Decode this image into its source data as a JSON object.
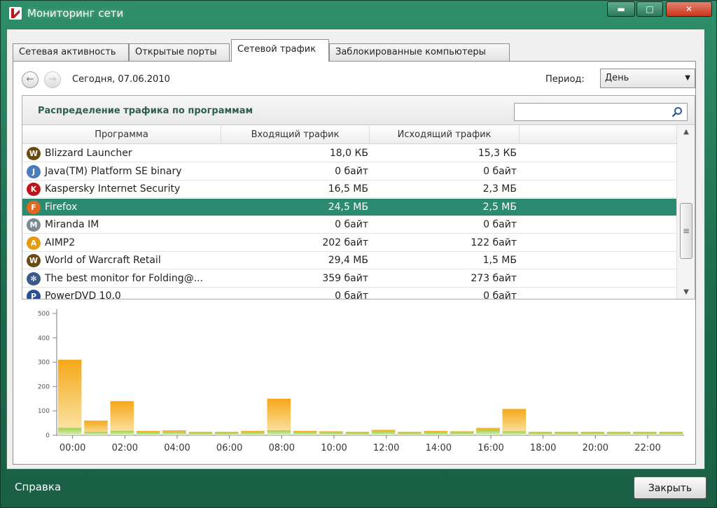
{
  "window": {
    "title": "Мониторинг сети",
    "minimize_glyph": "▬",
    "maximize_glyph": "□",
    "close_glyph": "✕"
  },
  "tabs": [
    {
      "label": "Сетевая активность",
      "active": false
    },
    {
      "label": "Открытые порты",
      "active": false
    },
    {
      "label": "Сетевой трафик",
      "active": true
    },
    {
      "label": "Заблокированные компьютеры",
      "active": false
    }
  ],
  "navigation": {
    "prev_glyph": "←",
    "next_glyph": "→",
    "date_label": "Сегодня, 07.06.2010",
    "period_label": "Период:",
    "period_value": "День"
  },
  "group": {
    "title": "Распределение трафика по программам",
    "search_value": "",
    "columns": [
      "Программа",
      "Входящий трафик",
      "Исходящий трафик"
    ]
  },
  "rows": [
    {
      "name": "Blizzard Launcher",
      "in": "18,0 КБ",
      "out": "15,3 КБ",
      "icon": "blizzard-icon",
      "icon_color": "#6b4a12",
      "icon_glyph": "W"
    },
    {
      "name": "Java(TM) Platform SE binary",
      "in": "0 байт",
      "out": "0 байт",
      "icon": "java-icon",
      "icon_color": "#4b7bbd",
      "icon_glyph": "J"
    },
    {
      "name": "Kaspersky Internet Security",
      "in": "16,5 МБ",
      "out": "2,3 МБ",
      "icon": "kaspersky-icon",
      "icon_color": "#c0141c",
      "icon_glyph": "K"
    },
    {
      "name": "Firefox",
      "in": "24,5 МБ",
      "out": "2,5 МБ",
      "icon": "firefox-icon",
      "icon_color": "#e2681d",
      "icon_glyph": "F",
      "selected": true
    },
    {
      "name": "Miranda IM",
      "in": "0 байт",
      "out": "0 байт",
      "icon": "miranda-icon",
      "icon_color": "#7d8a93",
      "icon_glyph": "M"
    },
    {
      "name": "AIMP2",
      "in": "202 байт",
      "out": "122 байт",
      "icon": "aimp-icon",
      "icon_color": "#e59a0c",
      "icon_glyph": "A"
    },
    {
      "name": "World of Warcraft Retail",
      "in": "29,4 МБ",
      "out": "1,5 МБ",
      "icon": "warcraft-icon",
      "icon_color": "#6b4a12",
      "icon_glyph": "W"
    },
    {
      "name": "The best monitor for Folding@...",
      "in": "359 байт",
      "out": "273 байт",
      "icon": "folding-icon",
      "icon_color": "#3a5a8c",
      "icon_glyph": "✻"
    },
    {
      "name": "PowerDVD 10.0",
      "in": "0 байт",
      "out": "0 байт",
      "icon": "powerdvd-icon",
      "icon_color": "#2d4f8f",
      "icon_glyph": "P"
    }
  ],
  "scrollbar": {
    "up_glyph": "▲",
    "down_glyph": "▼",
    "thumb_glyph": "≡"
  },
  "colors": {
    "selected_row": "#2c8a70",
    "bar_incoming": "#f5a818",
    "bar_outgoing": "#9fd04a"
  },
  "chart_data": {
    "type": "bar",
    "y_ticks": [
      "500",
      "400",
      "300",
      "200",
      "100",
      "0"
    ],
    "ylim": [
      0,
      500
    ],
    "x_tick_labels": [
      "00:00",
      "02:00",
      "04:00",
      "06:00",
      "08:00",
      "10:00",
      "12:00",
      "14:00",
      "16:00",
      "18:00",
      "20:00",
      "22:00"
    ],
    "categories": [
      "00",
      "01",
      "02",
      "03",
      "04",
      "05",
      "06",
      "07",
      "08",
      "09",
      "10",
      "11",
      "12",
      "13",
      "14",
      "15",
      "16",
      "17",
      "18",
      "19",
      "20",
      "21",
      "22",
      "23"
    ],
    "series": [
      {
        "values": [
          310,
          60,
          140,
          18,
          20,
          14,
          14,
          18,
          150,
          18,
          16,
          14,
          22,
          14,
          18,
          16,
          30,
          108,
          14,
          14,
          14,
          14,
          14,
          14
        ]
      },
      {
        "values": [
          30,
          14,
          18,
          12,
          14,
          10,
          10,
          12,
          20,
          14,
          12,
          10,
          16,
          10,
          12,
          12,
          22,
          16,
          10,
          10,
          10,
          10,
          10,
          10
        ]
      }
    ]
  },
  "footer": {
    "help_label": "Справка",
    "close_label": "Закрыть"
  }
}
